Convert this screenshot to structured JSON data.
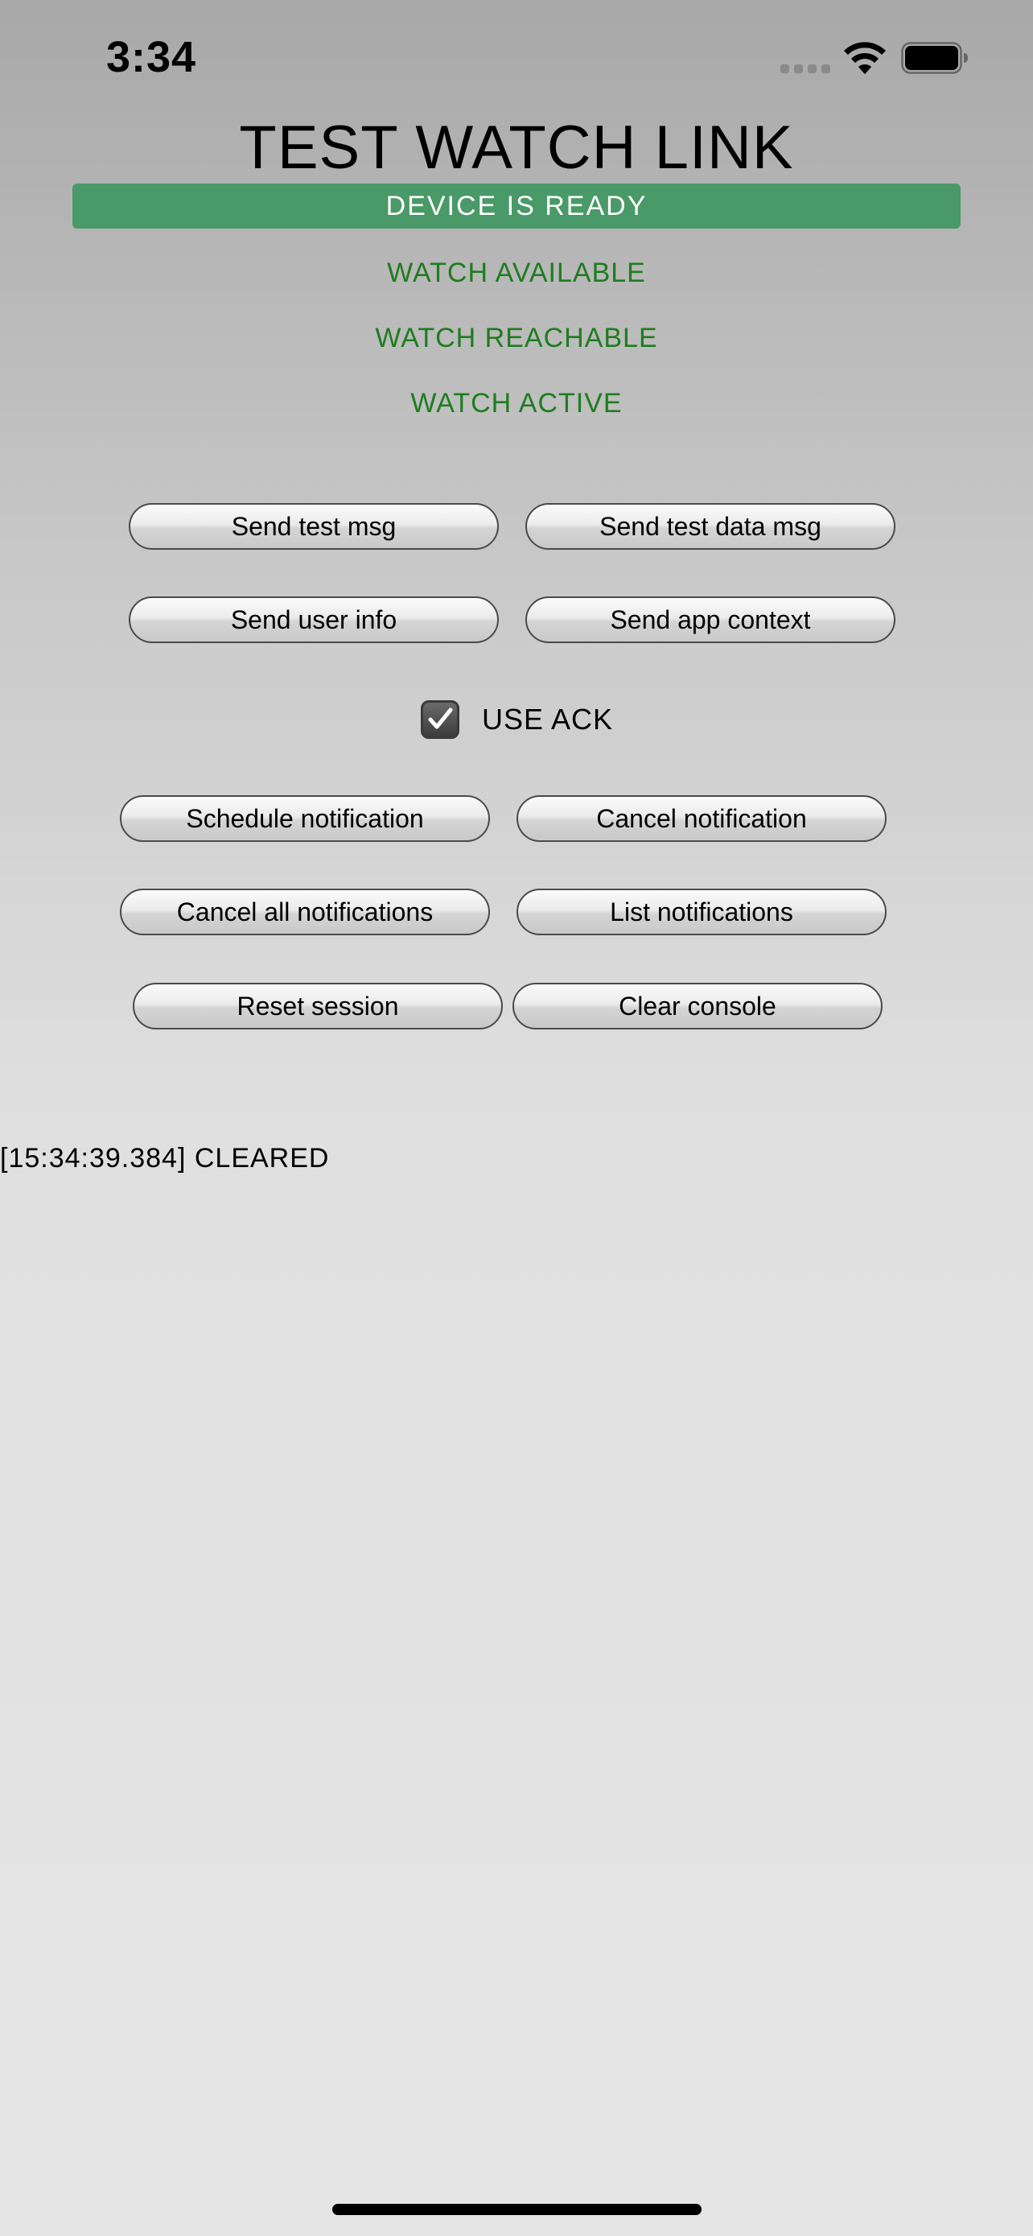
{
  "status_bar": {
    "time": "3:34",
    "icons": [
      "signal-icon",
      "wifi-icon",
      "battery-icon"
    ]
  },
  "title": "TEST WATCH LINK",
  "banner": {
    "text": "DEVICE IS READY",
    "color": "#4a9968"
  },
  "watch_status": {
    "available": "WATCH AVAILABLE",
    "reachable": "WATCH REACHABLE",
    "active": "WATCH ACTIVE",
    "color": "#1e7d1e"
  },
  "buttons": {
    "send_test_msg": "Send test msg",
    "send_test_data_msg": "Send test data msg",
    "send_user_info": "Send user info",
    "send_app_context": "Send app context",
    "schedule_notification": "Schedule notification",
    "cancel_notification": "Cancel notification",
    "cancel_all_notifications": "Cancel all notifications",
    "list_notifications": "List notifications",
    "reset_session": "Reset session",
    "clear_console": "Clear console"
  },
  "use_ack": {
    "label": "USE ACK",
    "checked": true
  },
  "console": {
    "lines": [
      "[15:34:39.384] CLEARED"
    ]
  }
}
